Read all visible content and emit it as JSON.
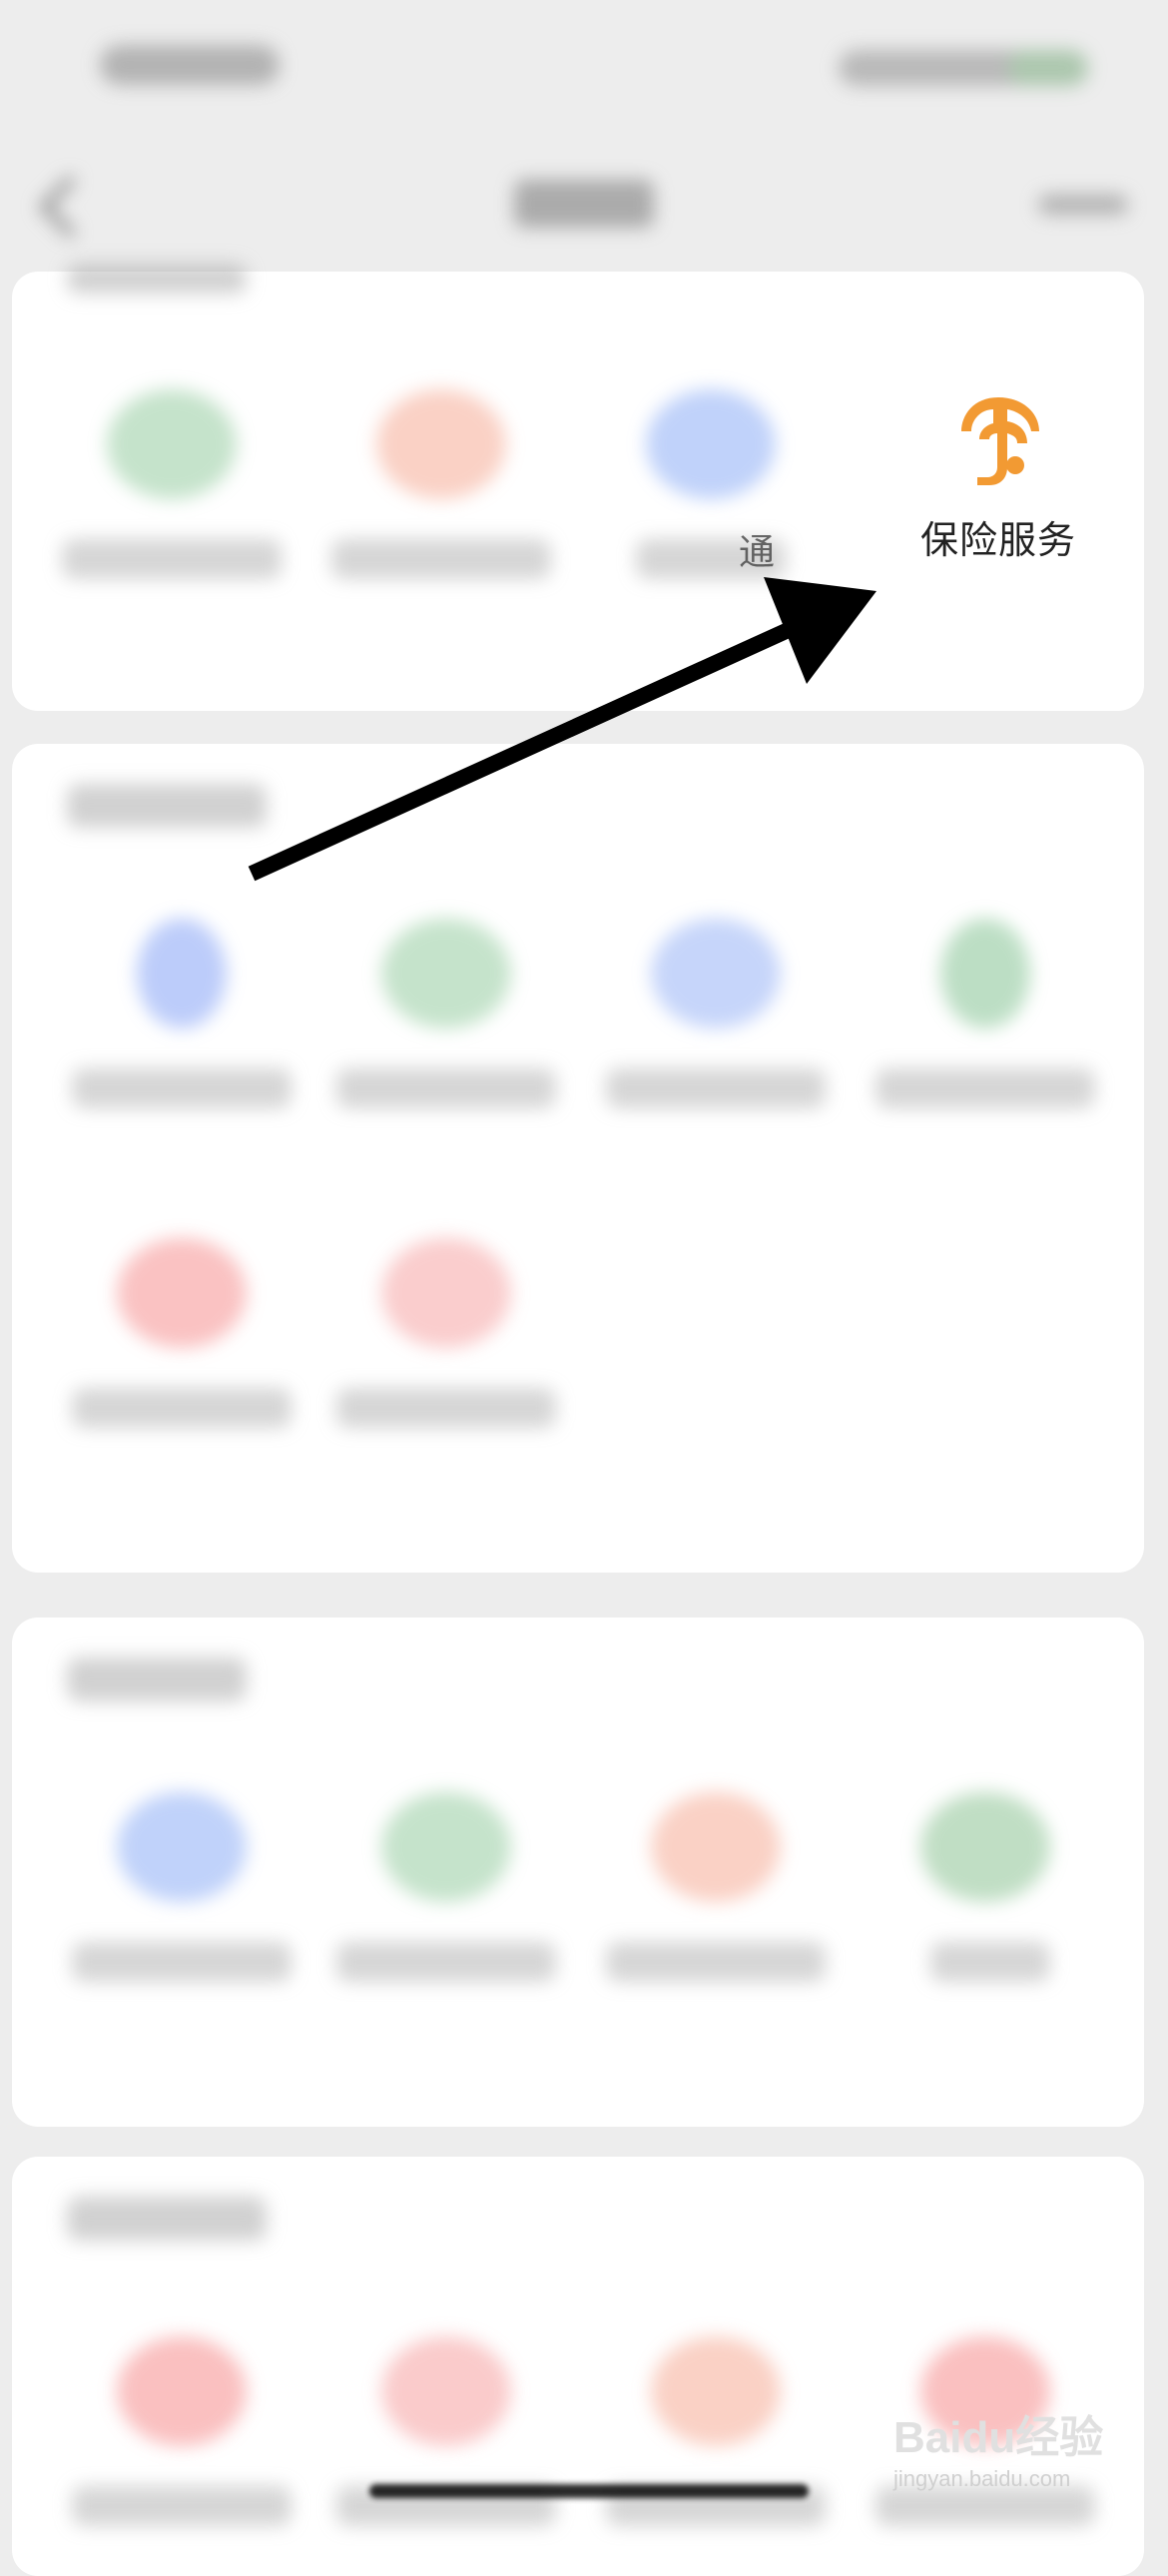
{
  "highlight_item": {
    "label": "保险服务",
    "icon": "insurance-umbrella-icon",
    "color": "#f29a33"
  },
  "partial_label": "通",
  "watermark": {
    "brand": "Baidu经验",
    "site": "jingyan.baidu.com"
  },
  "colors": {
    "background": "#ededed",
    "card": "#ffffff",
    "accent": "#f29a33",
    "arrow": "#000000"
  }
}
